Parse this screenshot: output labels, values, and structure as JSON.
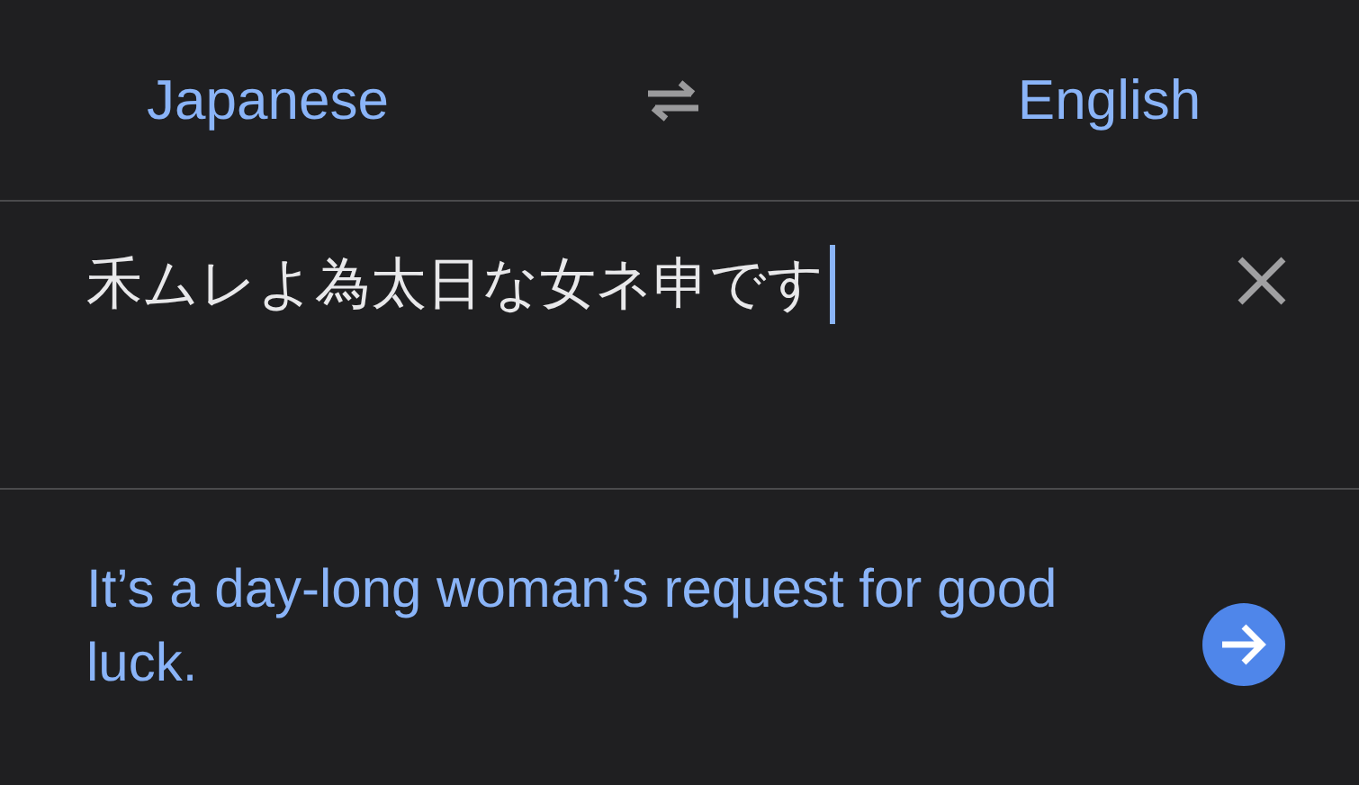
{
  "languages": {
    "source": "Japanese",
    "target": "English"
  },
  "input": {
    "value": "禾ムレよ為太日な女ネ申です"
  },
  "translation": {
    "text": "It’s a day-long woman’s request for good luck."
  }
}
